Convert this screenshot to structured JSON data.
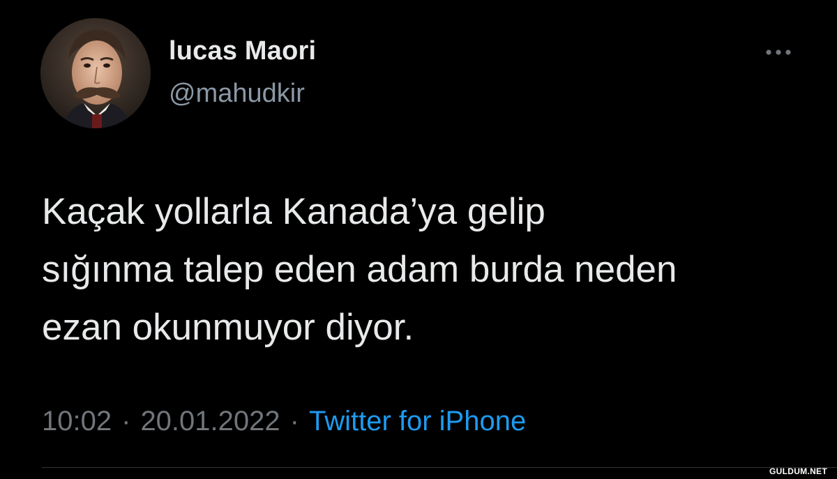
{
  "tweet": {
    "display_name": "lucas Maori",
    "handle": "@mahudkir",
    "text": "Kaçak yollarla Kanada’ya gelip\nsığınma talep eden adam burda neden\nezan okunmuyor diyor.",
    "time": "10:02",
    "date": "20.01.2022",
    "separator": "·",
    "source": "Twitter for iPhone",
    "more_icon": "more-horizontal-icon"
  },
  "watermark": "GULDUM.NET",
  "colors": {
    "background": "#000000",
    "primary_text": "#e7e9ea",
    "secondary_text": "#71767b",
    "link": "#1d9bf0"
  }
}
